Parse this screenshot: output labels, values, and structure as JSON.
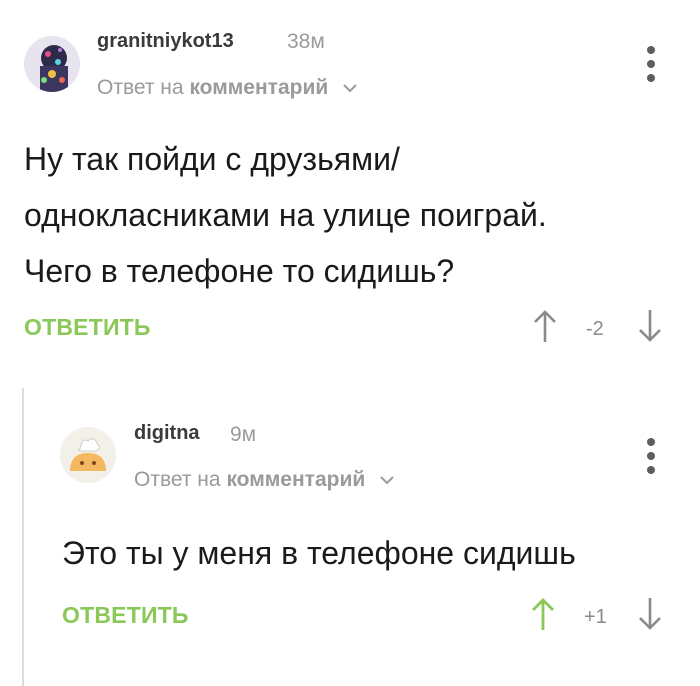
{
  "comments": [
    {
      "username": "granitniykot13",
      "time": "38м",
      "reply_prefix": "Ответ на",
      "reply_target": "комментарий",
      "text_lines": [
        "Ну так пойди с друзьями/",
        "однокласниками на улице поиграй.",
        "Чего в телефоне то сидишь?"
      ],
      "reply_label": "ОТВЕТИТЬ",
      "rating": "-2",
      "vote_state": "none"
    },
    {
      "username": "digitna",
      "time": "9м",
      "reply_prefix": "Ответ на",
      "reply_target": "комментарий",
      "text_lines": [
        "Это ты у меня в телефоне сидишь"
      ],
      "reply_label": "ОТВЕТИТЬ",
      "rating": "+1",
      "vote_state": "up"
    }
  ],
  "colors": {
    "accent_green": "#8ac858",
    "muted": "#9a9a9a",
    "arrow_gray": "#8a8a8a"
  }
}
